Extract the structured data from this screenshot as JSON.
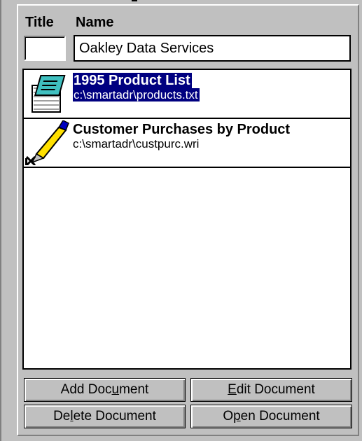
{
  "header": {
    "title_label": "Title",
    "name_label": "Name"
  },
  "fields": {
    "title_value": "",
    "name_value": "Oakley Data Services"
  },
  "documents": [
    {
      "title": "1995 Product List",
      "path": "c:\\smartadr\\products.txt",
      "icon": "notepad-icon",
      "selected": true
    },
    {
      "title": "Customer Purchases by Product",
      "path": "c:\\smartadr\\custpurc.wri",
      "icon": "write-pen-icon",
      "selected": false
    }
  ],
  "buttons": {
    "add": {
      "pre": "Add Doc",
      "mnemonic": "u",
      "post": "ment"
    },
    "edit": {
      "pre": "",
      "mnemonic": "E",
      "post": "dit Document"
    },
    "delete": {
      "pre": "De",
      "mnemonic": "l",
      "post": "ete Document"
    },
    "open": {
      "pre": "O",
      "mnemonic": "p",
      "post": "en Document"
    }
  },
  "colors": {
    "face": "#c0c0c0",
    "selection": "#000080"
  }
}
